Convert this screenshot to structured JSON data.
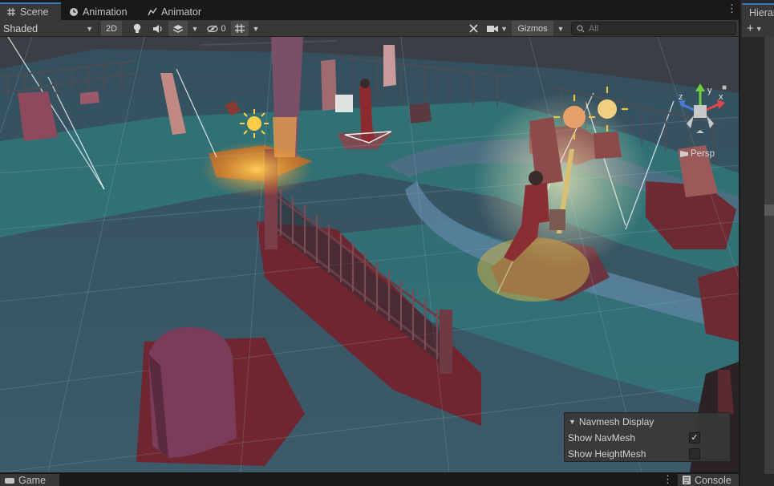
{
  "tabs": [
    {
      "label": "Scene",
      "icon": "grid-icon",
      "active": true
    },
    {
      "label": "Animation",
      "icon": "clock-icon",
      "active": false
    },
    {
      "label": "Animator",
      "icon": "animator-icon",
      "active": false
    }
  ],
  "toolbar": {
    "shading_mode": "Shaded",
    "mode_2d": "2D",
    "hidden_count": "0",
    "gizmos_label": "Gizmos",
    "search_placeholder": "All"
  },
  "hierarchy": {
    "tab_label": "Hierarchy",
    "add_label": "+"
  },
  "gizmo": {
    "x_label": "x",
    "y_label": "y",
    "z_label": "z",
    "projection": "Persp"
  },
  "navmesh_overlay": {
    "title": "Navmesh Display",
    "rows": [
      {
        "label": "Show NavMesh",
        "checked": true
      },
      {
        "label": "Show HeightMesh",
        "checked": false
      }
    ]
  },
  "bottom_tabs": [
    {
      "label": "Game",
      "icon": "game-icon"
    },
    {
      "label": "Console",
      "icon": "console-icon"
    }
  ],
  "colors": {
    "accent": "#3a79bb",
    "panel": "#383838",
    "navmesh": "#2c8f8a",
    "ground": "#3a5565",
    "obstacle": "#7a2a34"
  }
}
